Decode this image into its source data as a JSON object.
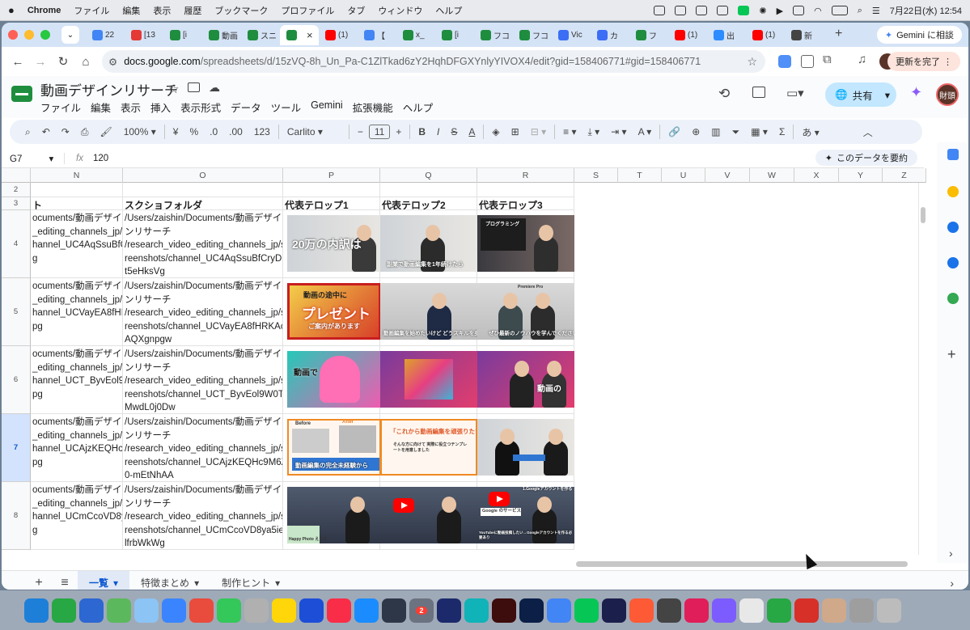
{
  "menubar": {
    "app": "Chrome",
    "items": [
      "ファイル",
      "編集",
      "表示",
      "履歴",
      "ブックマーク",
      "プロファイル",
      "タブ",
      "ウィンドウ",
      "ヘルプ"
    ],
    "datetime": "7月22日(水)  12:54"
  },
  "tabs": [
    {
      "label": "22",
      "color": "#4285f4"
    },
    {
      "label": "[13",
      "color": "#e53935"
    },
    {
      "label": "[i",
      "color": "#1e8e3e"
    },
    {
      "label": "動画",
      "color": "#1e8e3e"
    },
    {
      "label": "スニ",
      "color": "#1e8e3e"
    },
    {
      "label": "",
      "color": "#1e8e3e",
      "active": true
    },
    {
      "label": "(1)",
      "color": "#ff0000"
    },
    {
      "label": "【",
      "color": "#4285f4"
    },
    {
      "label": "x_",
      "color": "#1e8e3e"
    },
    {
      "label": "[i",
      "color": "#1e8e3e"
    },
    {
      "label": "フコ",
      "color": "#1e8e3e"
    },
    {
      "label": "フコ",
      "color": "#1e8e3e"
    },
    {
      "label": "Vic",
      "color": "#3b6ef5"
    },
    {
      "label": "カ",
      "color": "#3b6ef5"
    },
    {
      "label": "フ",
      "color": "#1e8e3e"
    },
    {
      "label": "(1)",
      "color": "#ff0000"
    },
    {
      "label": "出",
      "color": "#2d8cff"
    },
    {
      "label": "(1)",
      "color": "#ff0000"
    },
    {
      "label": "新",
      "color": "#444"
    }
  ],
  "gemini_button": "Gemini に相談",
  "url": {
    "domain": "docs.google.com",
    "path": "/spreadsheets/d/15zVQ-8h_Un_Pa-C1ZlTkad6zY2HqhDFGXYnlyYIVOX4/edit?gid=158406771#gid=158406771"
  },
  "update_button": "更新を完了",
  "document": {
    "title": "動画デザインリサーチ",
    "menus": [
      "ファイル",
      "編集",
      "表示",
      "挿入",
      "表示形式",
      "データ",
      "ツール",
      "Gemini",
      "拡張機能",
      "ヘルプ"
    ],
    "share_label": "共有",
    "avatar_text": "財頭"
  },
  "toolbar": {
    "zoom": "100%",
    "currency": "¥",
    "percent": "%",
    "dec_less": ".0",
    "dec_more": ".00",
    "number_format": "123",
    "font": "Carlito",
    "font_size": "11",
    "ime_label": "あ"
  },
  "formula_bar": {
    "cell_ref": "G7",
    "fx": "fx",
    "value": "120",
    "summarize": "このデータを要約"
  },
  "columns": [
    "N",
    "O",
    "P",
    "Q",
    "R",
    "S",
    "T",
    "U",
    "V",
    "W",
    "X",
    "Y",
    "Z"
  ],
  "rows": [
    {
      "num": "2",
      "n": "",
      "o": ""
    },
    {
      "num": "3",
      "n": "ト",
      "o": "スクショフォルダ",
      "header": true
    },
    {
      "num": "4",
      "n": "ocuments/動画デザイ\n_editing_channels_jp/c\nhannel_UC4AqSsuBfCry\ng",
      "o": "/Users/zaishin/Documents/動画デザイ\nンリサーチ\n/research_video_editing_channels_jp/sc\nreenshots/channel_UC4AqSsuBfCryDHN\nt5eHksVg"
    },
    {
      "num": "5",
      "n": "ocuments/動画デザイ\n_editing_channels_jp/c\nhannel_UCVayEA8fHRK\npg",
      "o": "/Users/zaishin/Documents/動画デザイ\nンリサーチ\n/research_video_editing_channels_jp/sc\nreenshots/channel_UCVayEA8fHRKAc18\nAQXgnpgw"
    },
    {
      "num": "6",
      "n": "ocuments/動画デザイ\n_editing_channels_jp/c\nhannel_UCT_ByvEol9W\npg",
      "o": "/Users/zaishin/Documents/動画デザイ\nンリサーチ\n/research_video_editing_channels_jp/sc\nreenshots/channel_UCT_ByvEol9W0T6\nMwdL0j0Dw"
    },
    {
      "num": "7",
      "n": "ocuments/動画デザイ\n_editing_channels_jp/c\nhannel_UCAjzKEQHc9M\npg",
      "o": "/Users/zaishin/Documents/動画デザイ\nンリサーチ\n/research_video_editing_channels_jp/sc\nreenshots/channel_UCAjzKEQHc9M6ZR\n0-mEtNhAA",
      "selected": true
    },
    {
      "num": "8",
      "n": "ocuments/動画デザイ\n_editing_channels_jp/c\nhannel_UCmCcoVD8ya5\ng",
      "o": "/Users/zaishin/Documents/動画デザイ\nンリサーチ\n/research_video_editing_channels_jp/sc\nreenshots/channel_UCmCcoVD8ya5ie59\nlfrbWkWg"
    }
  ],
  "header_telops": [
    "代表テロップ1",
    "代表テロップ2",
    "代表テロップ3"
  ],
  "thumb_texts": {
    "r4p": "20万の内訳は",
    "r4q": "副業で動画編集を1年続けたら",
    "r4r": "プログラミング",
    "r5p1": "動画の途中に",
    "r5p2": "プレゼント",
    "r5p3": "ご案内があります",
    "r5q": "動画編集を始めたいけど どうスキルを身に付ければ…",
    "r5r": "ぜひ最新のノウハウを学んでください",
    "r5r_top": "Premiere Pro",
    "r6p": "動画で",
    "r6r": "動画の",
    "r7p1": "動画編集の完全未経験から",
    "r7p_before": "Before",
    "r7p_after": "After",
    "r7q1": "「これから動画編集を頑張りたい!」",
    "r7q2": "そんな方に向けて 実際に役立つテンプレートを用意しました",
    "r8p": "Happy Photo えりな",
    "r8r_top": "1.Googleアカウントを作る",
    "r8r1": "Google のサービス",
    "r8r2": "YouTubeに動画投稿したい→Googleアカウントを作る必要あり"
  },
  "sheet_tabs": [
    "一覧",
    "特徴まとめ",
    "制作ヒント"
  ],
  "dock_badge": "2"
}
